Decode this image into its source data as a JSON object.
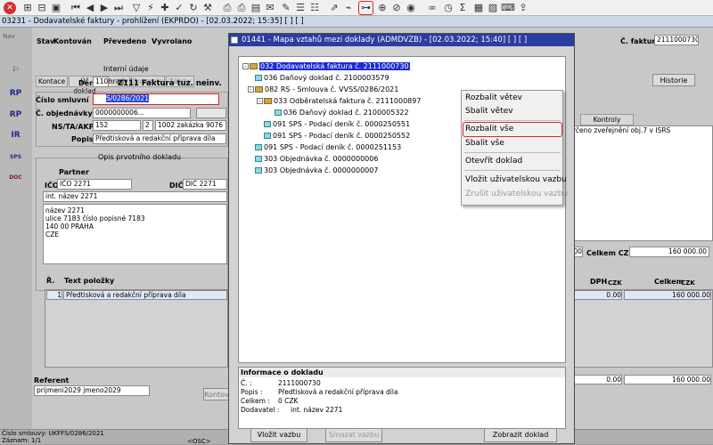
{
  "app": {
    "window_title": "03231 - Dodavatelské faktury - prohlížení (EKPRDO) - [02.03.2022; 15:35] [ ] [ ]"
  },
  "left_panel": {
    "nav_label": "Nav",
    "side_icons": [
      "RP",
      "RP",
      "IR",
      "SPS",
      "DOC"
    ]
  },
  "header": {
    "stav_label": "Stav",
    "stav_value": "Kontován",
    "prevedeno_label": "Převedeno",
    "vyvrolano_label": "Vyvrolano",
    "faktura_label": "Č. faktury",
    "faktura_value": "2111000730"
  },
  "tabs": [
    "Kontace",
    "Úč doklad",
    "Úhrady",
    "Dobropisy",
    "Zálohy"
  ],
  "form": {
    "interni_udaje": "Interní údaje",
    "denik_label": "Deník",
    "denik_code": "110",
    "denik_name": "Z111 Faktura tuz. neinv.",
    "cislo_smluvniho_label": "Číslo smluvní",
    "cislo_smluvniho_value": "S/0286/2021",
    "objednavky_label": "Č. objednávky",
    "objednavky_value": "0000000006...",
    "nsta_label": "NS/TA/AKP",
    "nsta_1": "152",
    "nsta_2": "2",
    "nsta_3": "1002 zakázka 9076",
    "popis_label": "Popis",
    "popis_value": "Předtisková a redakční příprava díla",
    "opis_label": "Opis prvotního dokladu",
    "partner_label": "Partner",
    "ico_label": "IČO",
    "ico_value": "IČO 2271",
    "dic_label": "DIČ",
    "dic_value": "DIČ 2271",
    "nazev_int": "int. název 2271",
    "address_lines": [
      "název 2271",
      "ulice 7183 číslo popisné 7183",
      "140 00 PRAHA",
      "CZE"
    ]
  },
  "right_area": {
    "historie_button": "Historie",
    "kontroly_tab": "Kontroly",
    "kontroly_text": "rčeno zveřejnění obj.7 v ISRS",
    "celkem_label": "Celkem CZK",
    "celkem_value": "160 000.00",
    "left_value_fragment": "00"
  },
  "items": {
    "r_label": "Ř.",
    "text_label": "Text položky",
    "dph_label": "DPH",
    "dph_unit": "CZK",
    "celkem_label": "Celkem",
    "celkem_unit": "CZK",
    "row1_num": "1",
    "row1_text": "Předtisková a redakční příprava díla",
    "row1_dph": "0.00",
    "row1_celkem": "160 000.00",
    "sum_dph": "0.00",
    "sum_celkem": "160 000.00"
  },
  "referent": {
    "label": "Referent",
    "value": "prijmeni2029 jmeno2029",
    "kontov_btn": "Kontov"
  },
  "status_bar": {
    "line1": "Číslo smlouvy: UKFFS/0286/2021",
    "line2": "Záznam: 1/1",
    "osc": "<OSC>"
  },
  "dialog": {
    "title": "01441 - Mapa vztahů mezi doklady (ADMDVZB) - [02.03.2022; 15:40] [ ] [ ]",
    "tree": [
      {
        "text": "032 Dodavatelská faktura č. 2111000730",
        "level": 0,
        "kind": "folder",
        "selected": true
      },
      {
        "text": "036 Daňový doklad č. 2100003579",
        "level": 1,
        "kind": "doc"
      },
      {
        "text": "082 RS - Smlouva č. VVSS/0286/2021",
        "level": 1,
        "kind": "folder"
      },
      {
        "text": "033 Odběratelská faktura č. 2111000897",
        "level": 2,
        "kind": "folder"
      },
      {
        "text": "036 Daňový doklad č. 2100005322",
        "level": 3,
        "kind": "doc"
      },
      {
        "text": "091 SPS - Podací deník č. 0000250551",
        "level": 2,
        "kind": "doc"
      },
      {
        "text": "091 SPS - Podací deník č. 0000250552",
        "level": 2,
        "kind": "doc"
      },
      {
        "text": "091 SPS - Podací deník č. 0000251153",
        "level": 1,
        "kind": "doc"
      },
      {
        "text": "303 Objednávka č. 0000000006",
        "level": 1,
        "kind": "doc"
      },
      {
        "text": "303 Objednávka č. 0000000007",
        "level": 1,
        "kind": "doc"
      }
    ],
    "context_menu": {
      "items": [
        "Rozbalit větev",
        "Sbalit větev",
        "Rozbalit vše",
        "Sbalit vše",
        "Otevřít doklad",
        "Vložit uživatelskou vazbu",
        "Zrušit uživatelskou vazbu"
      ]
    },
    "info": {
      "title": "Informace o dokladu",
      "rows": [
        {
          "label": "Č. :",
          "value": "2111000730"
        },
        {
          "label": "Popis :",
          "value": "Předtisková a redakční příprava díla"
        },
        {
          "label": "Celkem :",
          "value": "0 CZK"
        },
        {
          "label": "Dodavatel :",
          "value": "int. název 2271"
        }
      ]
    },
    "buttons": {
      "insert": "Vložit vazbu",
      "delete": "Smazat vazbu",
      "show": "Zobrazit doklad"
    }
  },
  "colors": {
    "dialog_title_bg": "#2a3ea0",
    "selection_bg": "#1a2cd0",
    "highlight_red": "#d62828"
  }
}
